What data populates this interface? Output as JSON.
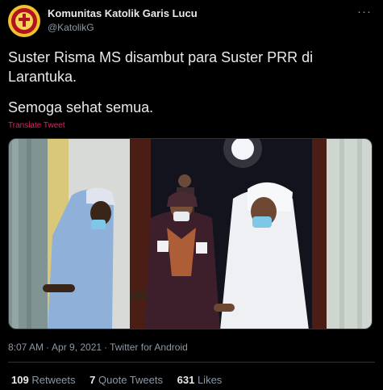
{
  "author": {
    "name": "Komunitas Katolik Garis Lucu",
    "handle": "@KatolikG"
  },
  "icons": {
    "more": "more-dots-icon",
    "avatar": "community-logo"
  },
  "tweet": {
    "line1": "Suster Risma MS disambut para Suster PRR di Larantuka.",
    "line2": "Semoga sehat semua.",
    "translate_label": "Translate Tweet"
  },
  "meta": {
    "time": "8:07 AM",
    "date": "Apr 9, 2021",
    "source": "Twitter for Android"
  },
  "stats": {
    "retweets_count": "109",
    "retweets_label": "Retweets",
    "quotes_count": "7",
    "quotes_label": "Quote Tweets",
    "likes_count": "631",
    "likes_label": "Likes"
  },
  "colors": {
    "background": "#000000",
    "translate_link": "#e0245e",
    "secondary_text": "#8b98a5"
  }
}
